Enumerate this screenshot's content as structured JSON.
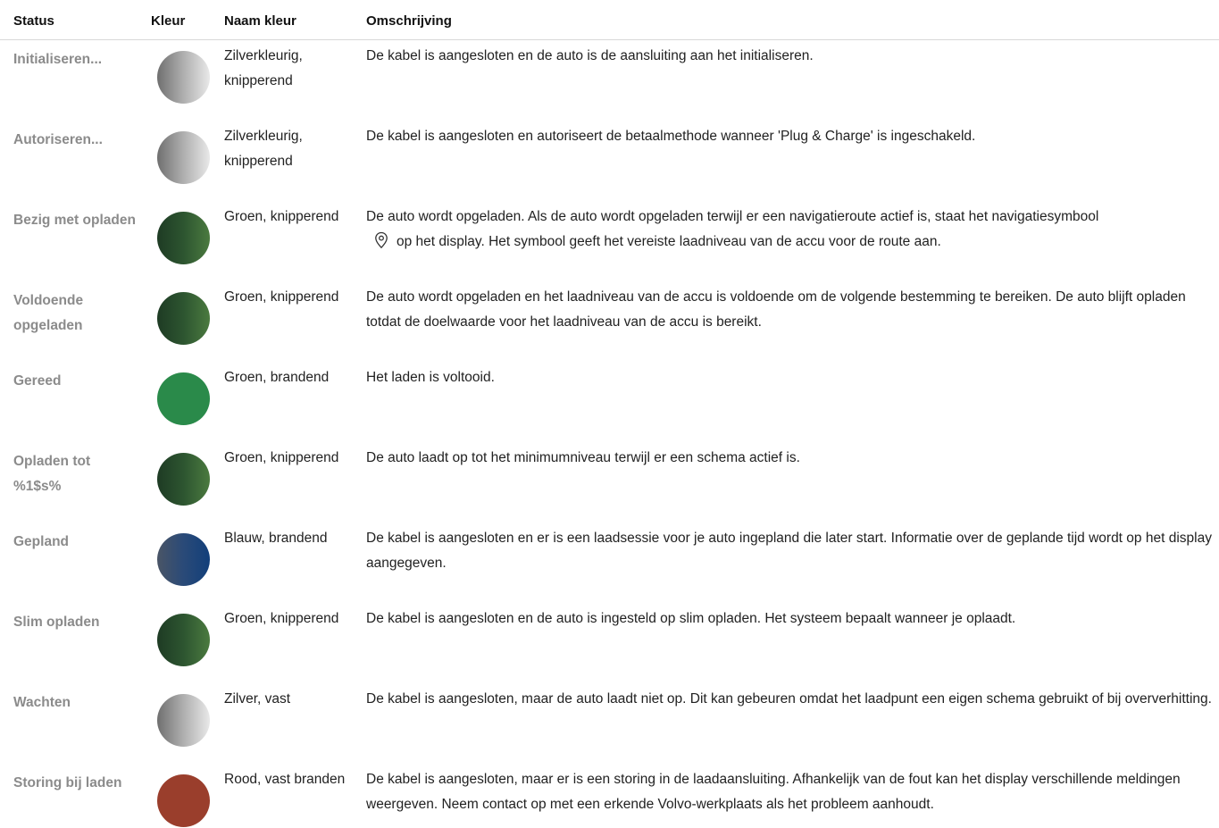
{
  "headers": {
    "status": "Status",
    "color": "Kleur",
    "name": "Naam kleur",
    "description": "Omschrijving"
  },
  "rows": [
    {
      "status": "Initialiseren...",
      "color_name": "Zilverkleurig, knipperend",
      "color": "silver-gradient",
      "description": "De kabel is aangesloten en de auto is de aansluiting aan het initialiseren."
    },
    {
      "status": "Autoriseren...",
      "color_name": "Zilverkleurig, knipperend",
      "color": "silver-gradient",
      "description": "De kabel is aangesloten en autoriseert de betaalmethode wanneer 'Plug & Charge' is ingeschakeld."
    },
    {
      "status": "Bezig met opladen",
      "color_name": "Groen, knipperend",
      "color": "green-gradient",
      "description_before": "De auto wordt opgeladen. Als de auto wordt opgeladen terwijl er een navigatieroute actief is, staat het navigatiesymbool",
      "description_icon": "location-pin-icon",
      "description_after": "op het display. Het symbool geeft het vereiste laadniveau van de accu voor de route aan."
    },
    {
      "status": "Voldoende opgeladen",
      "color_name": "Groen, knipperend",
      "color": "green-gradient",
      "description": "De auto wordt opgeladen en het laadniveau van de accu is voldoende om de volgende bestemming te bereiken. De auto blijft opladen totdat de doelwaarde voor het laadniveau van de accu is bereikt."
    },
    {
      "status": "Gereed",
      "color_name": "Groen, brandend",
      "color": "#2a8a4a",
      "description": "Het laden is voltooid."
    },
    {
      "status": "Opladen tot %1$s%",
      "color_name": "Groen, knipperend",
      "color": "green-gradient",
      "description": "De auto laadt op tot het minimumniveau terwijl er een schema actief is."
    },
    {
      "status": "Gepland",
      "color_name": "Blauw, brandend",
      "color": "blue-gradient",
      "description": "De kabel is aangesloten en er is een laadsessie voor je auto ingepland die later start. Informatie over de geplande tijd wordt op het display aangegeven."
    },
    {
      "status": "Slim opladen",
      "color_name": "Groen, knipperend",
      "color": "green-gradient",
      "description": "De kabel is aangesloten en de auto is ingesteld op slim opladen. Het systeem bepaalt wanneer je oplaadt."
    },
    {
      "status": "Wachten",
      "color_name": "Zilver, vast",
      "color": "silver-gradient",
      "description": "De kabel is aangesloten, maar de auto laadt niet op. Dit kan gebeuren omdat het laadpunt een eigen schema gebruikt of bij oververhitting."
    },
    {
      "status": "Storing bij laden",
      "color_name": "Rood, vast branden",
      "color": "#9a3e2c",
      "description": "De kabel is aangesloten, maar er is een storing in de laadaansluiting. Afhankelijk van de fout kan het display verschillende meldingen weergeven. Neem contact op met een erkende Volvo-werkplaats als het probleem aanhoudt."
    }
  ]
}
